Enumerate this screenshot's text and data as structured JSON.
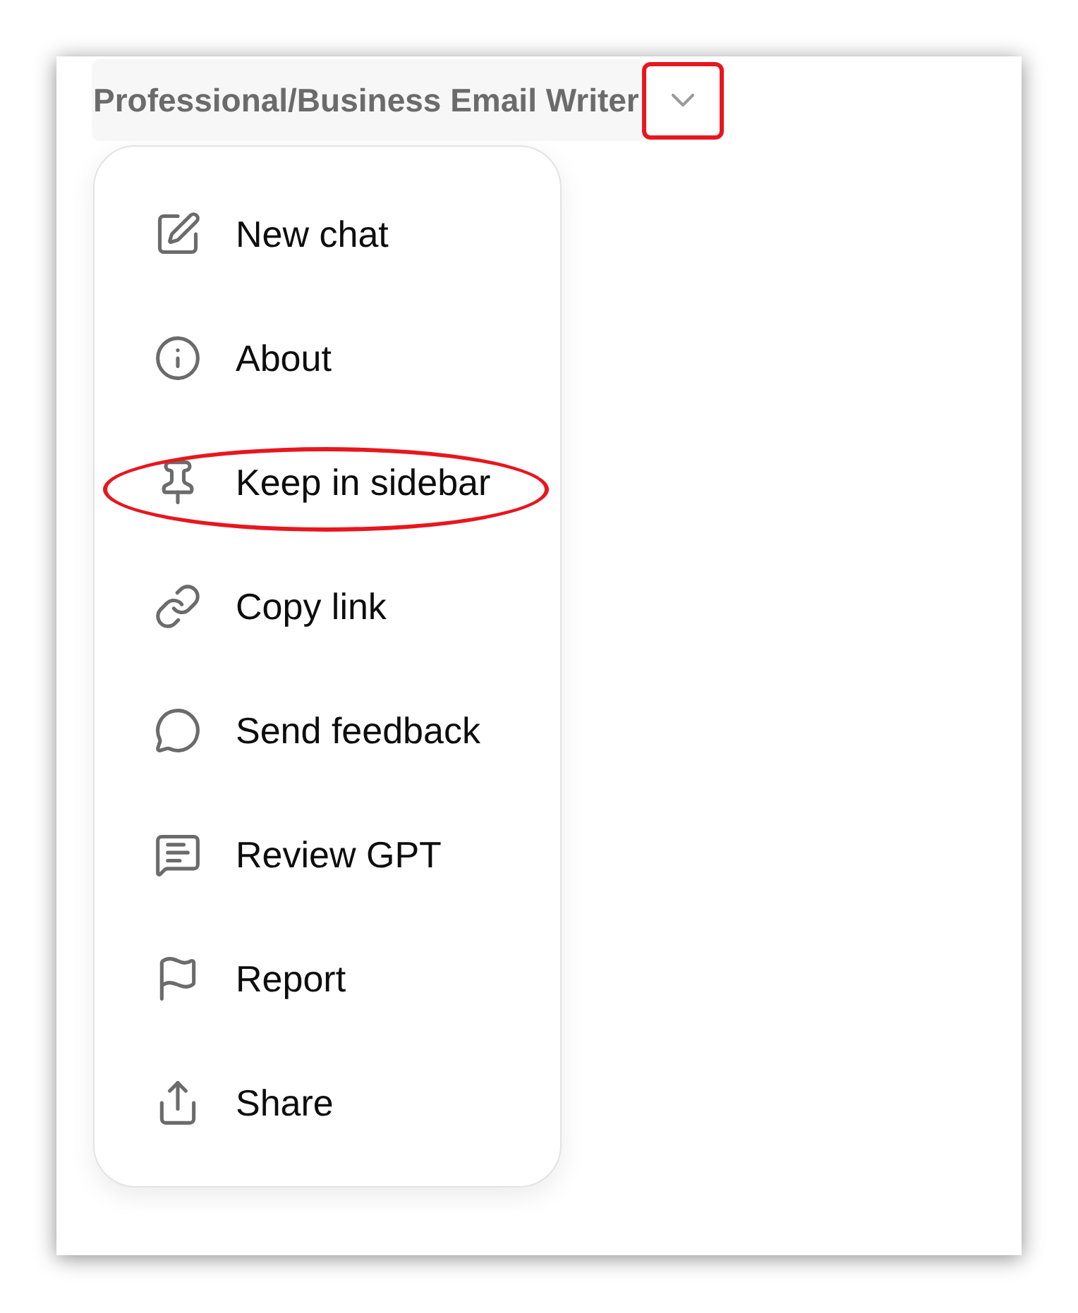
{
  "header": {
    "title": "Professional/Business Email Writer",
    "chevron_highlighted": true
  },
  "menu": {
    "items": [
      {
        "label": "New chat",
        "highlighted": false
      },
      {
        "label": "About",
        "highlighted": false
      },
      {
        "label": "Keep in sidebar",
        "highlighted": true
      },
      {
        "label": "Copy link",
        "highlighted": false
      },
      {
        "label": "Send feedback",
        "highlighted": false
      },
      {
        "label": "Review GPT",
        "highlighted": false
      },
      {
        "label": "Report",
        "highlighted": false
      },
      {
        "label": "Share",
        "highlighted": false
      }
    ]
  }
}
